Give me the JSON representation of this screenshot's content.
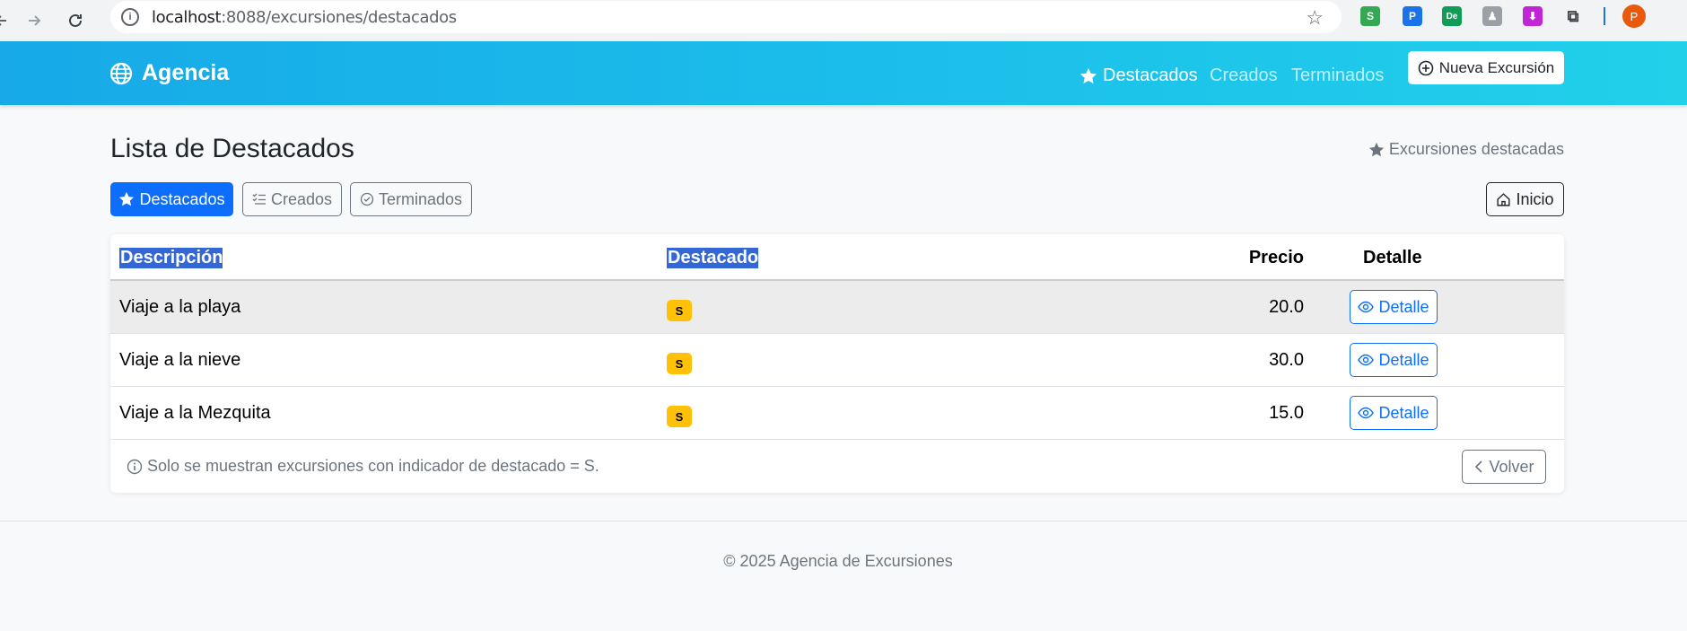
{
  "browser": {
    "url_host": "localhost",
    "url_rest": ":8088/excursiones/destacados",
    "profile_initial": "P"
  },
  "navbar": {
    "brand": "Agencia",
    "links": [
      {
        "label": "Destacados"
      },
      {
        "label": "Creados"
      },
      {
        "label": "Terminados"
      }
    ],
    "new_button": "Nueva Excursión"
  },
  "page": {
    "title": "Lista de Destacados",
    "subtitle": "Excursiones destacadas"
  },
  "tabs": {
    "destacados": "Destacados",
    "creados": "Creados",
    "terminados": "Terminados",
    "inicio": "Inicio"
  },
  "table": {
    "headers": [
      "Descripción",
      "Destacado",
      "Precio",
      "Detalle"
    ],
    "rows": [
      {
        "descripcion": "Viaje a la playa",
        "destacado": "S",
        "precio": "20.0",
        "detalle": "Detalle"
      },
      {
        "descripcion": "Viaje a la nieve",
        "destacado": "S",
        "precio": "30.0",
        "detalle": "Detalle"
      },
      {
        "descripcion": "Viaje a la Mezquita",
        "destacado": "S",
        "precio": "15.0",
        "detalle": "Detalle"
      }
    ],
    "note": "Solo se muestran excursiones con indicador de destacado = S.",
    "back_button": "Volver"
  },
  "footer": {
    "copyright": "© 2025 Agencia de Excursiones"
  },
  "colors": {
    "primary": "#0d6efd",
    "navbar_start": "#17a9e8",
    "navbar_end": "#22d0ea",
    "badge": "#ffc107",
    "selection": "#3367d6"
  }
}
